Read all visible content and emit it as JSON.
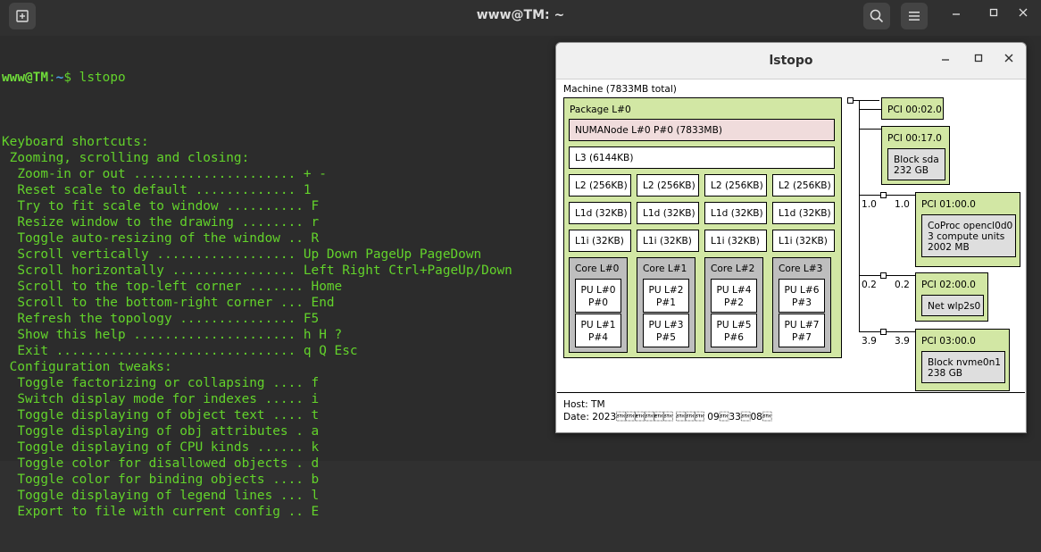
{
  "terminal": {
    "title": "www@TM: ~",
    "prompt_user": "www@TM",
    "prompt_path": "~",
    "prompt_symbol": "$",
    "command": "lstopo",
    "lines": [
      "",
      "Keyboard shortcuts:",
      " Zooming, scrolling and closing:",
      "  Zoom-in or out ..................... + -",
      "  Reset scale to default ............. 1",
      "  Try to fit scale to window .......... F",
      "  Resize window to the drawing ........ r",
      "  Toggle auto-resizing of the window .. R",
      "  Scroll vertically .................. Up Down PageUp PageDown",
      "  Scroll horizontally ................ Left Right Ctrl+PageUp/Down",
      "  Scroll to the top-left corner ....... Home",
      "  Scroll to the bottom-right corner ... End",
      "  Refresh the topology ............... F5",
      "  Show this help ..................... h H ?",
      "  Exit ............................... q Q Esc",
      " Configuration tweaks:",
      "  Toggle factorizing or collapsing .... f",
      "  Switch display mode for indexes ..... i",
      "  Toggle displaying of object text .... t",
      "  Toggle displaying of obj attributes . a",
      "  Toggle displaying of CPU kinds ...... k",
      "  Toggle color for disallowed objects . d",
      "  Toggle color for binding objects .... b",
      "  Toggle displaying of legend lines ... l",
      "  Export to file with current config .. E"
    ],
    "icons": {
      "new_tab": "new-tab-icon",
      "search": "search-icon",
      "menu": "hamburger-menu-icon",
      "minimize": "minimize-icon",
      "maximize": "maximize-icon",
      "close": "close-icon"
    }
  },
  "lstopo": {
    "title": "lstopo",
    "machine": "Machine (7833MB total)",
    "package": "Package L#0",
    "numa": "NUMANode L#0 P#0 (7833MB)",
    "l3": "L3 (6144KB)",
    "l2": [
      "L2 (256KB)",
      "L2 (256KB)",
      "L2 (256KB)",
      "L2 (256KB)"
    ],
    "l1d": [
      "L1d (32KB)",
      "L1d (32KB)",
      "L1d (32KB)",
      "L1d (32KB)"
    ],
    "l1i": [
      "L1i (32KB)",
      "L1i (32KB)",
      "L1i (32KB)",
      "L1i (32KB)"
    ],
    "cores": [
      {
        "label": "Core L#0",
        "pus": [
          {
            "l1": "PU L#0",
            "l2": "P#0"
          },
          {
            "l1": "PU L#1",
            "l2": "P#4"
          }
        ]
      },
      {
        "label": "Core L#1",
        "pus": [
          {
            "l1": "PU L#2",
            "l2": "P#1"
          },
          {
            "l1": "PU L#3",
            "l2": "P#5"
          }
        ]
      },
      {
        "label": "Core L#2",
        "pus": [
          {
            "l1": "PU L#4",
            "l2": "P#2"
          },
          {
            "l1": "PU L#5",
            "l2": "P#6"
          }
        ]
      },
      {
        "label": "Core L#3",
        "pus": [
          {
            "l1": "PU L#6",
            "l2": "P#3"
          },
          {
            "l1": "PU L#7",
            "l2": "P#7"
          }
        ]
      }
    ],
    "pci": [
      {
        "label": "PCI 00:02.0"
      },
      {
        "label": "PCI 00:17.0",
        "dev": [
          "Block sda",
          "232 GB"
        ]
      },
      {
        "label": "PCI 01:00.0",
        "dev": [
          "CoProc opencl0d0",
          "3 compute units",
          "2002 MB"
        ],
        "bw_left": "1.0",
        "bw_right": "1.0"
      },
      {
        "label": "PCI 02:00.0",
        "dev": [
          "Net wlp2s0"
        ],
        "bw_left": "0.2",
        "bw_right": "0.2"
      },
      {
        "label": "PCI 03:00.0",
        "dev": [
          "Block nvme0n1",
          "238 GB"
        ],
        "bw_left": "3.9",
        "bw_right": "3.9"
      }
    ],
    "host": "Host: TM",
    "date": "Date: 2023\u0002\u0002\u0003\u0002\u0003\u0002 \u0002\u0002\u0002 09\u000233\u000208\u0002"
  }
}
